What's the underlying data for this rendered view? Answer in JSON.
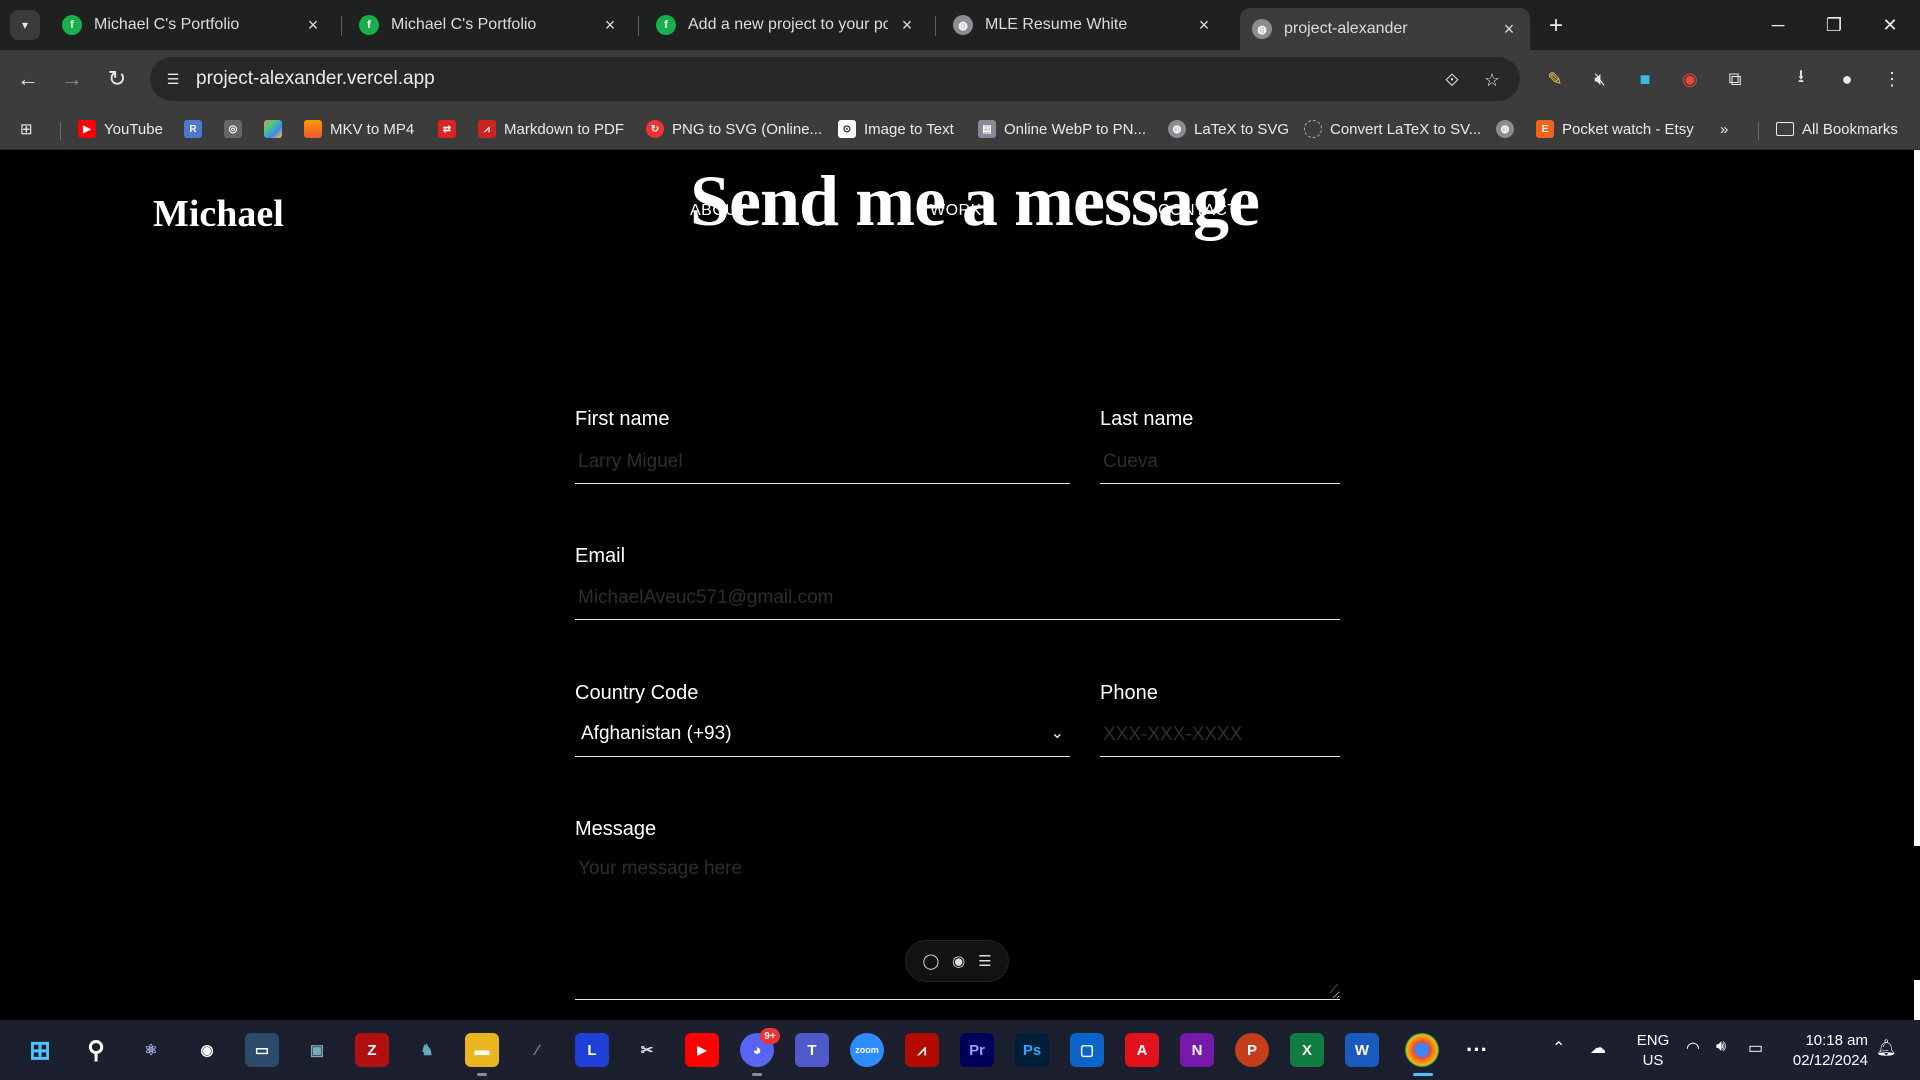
{
  "browser": {
    "tabs": [
      {
        "title": "Michael C's Portfolio",
        "favicon": "framer-f-icon"
      },
      {
        "title": "Michael C's Portfolio",
        "favicon": "framer-f-icon"
      },
      {
        "title": "Add a new project to your portf",
        "favicon": "framer-f-icon"
      },
      {
        "title": "MLE Resume White",
        "favicon": "globe-icon"
      },
      {
        "title": "project-alexander",
        "favicon": "globe-icon"
      }
    ],
    "url": "project-alexander.vercel.app",
    "bookmarks": [
      {
        "label": "YouTube"
      },
      {
        "label": "MKV to MP4"
      },
      {
        "label": "Markdown to PDF"
      },
      {
        "label": "PNG to SVG (Online..."
      },
      {
        "label": "Image to Text"
      },
      {
        "label": "Online WebP to PN..."
      },
      {
        "label": "LaTeX to SVG"
      },
      {
        "label": "Convert LaTeX to SV..."
      },
      {
        "label": "Pocket watch - Etsy"
      }
    ],
    "all_bookmarks_label": "All Bookmarks"
  },
  "site": {
    "logo": "Michael",
    "nav": {
      "about": "ABOUT",
      "work": "WORK",
      "contact": "CONTACT"
    },
    "heading": "Send me a message",
    "form": {
      "first_name_label": "First name",
      "first_name_placeholder": "Larry Miguel",
      "last_name_label": "Last name",
      "last_name_placeholder": "Cueva",
      "email_label": "Email",
      "email_placeholder": "MichaelAveuc571@gmail.com",
      "country_label": "Country Code",
      "country_value": "Afghanistan (+93)",
      "phone_label": "Phone",
      "phone_placeholder": "XXX-XXX-XXXX",
      "message_label": "Message",
      "message_placeholder": "Your message here"
    }
  },
  "taskbar": {
    "lang_top": "ENG",
    "lang_bottom": "US",
    "time": "10:18 am",
    "date": "02/12/2024",
    "discord_badge": "9+"
  },
  "colors": {
    "page_bg": "#000000",
    "chrome_bg": "#3c3c3c",
    "tabstrip_bg": "#1f2020",
    "taskbar_bg": "#1c1f2e"
  }
}
